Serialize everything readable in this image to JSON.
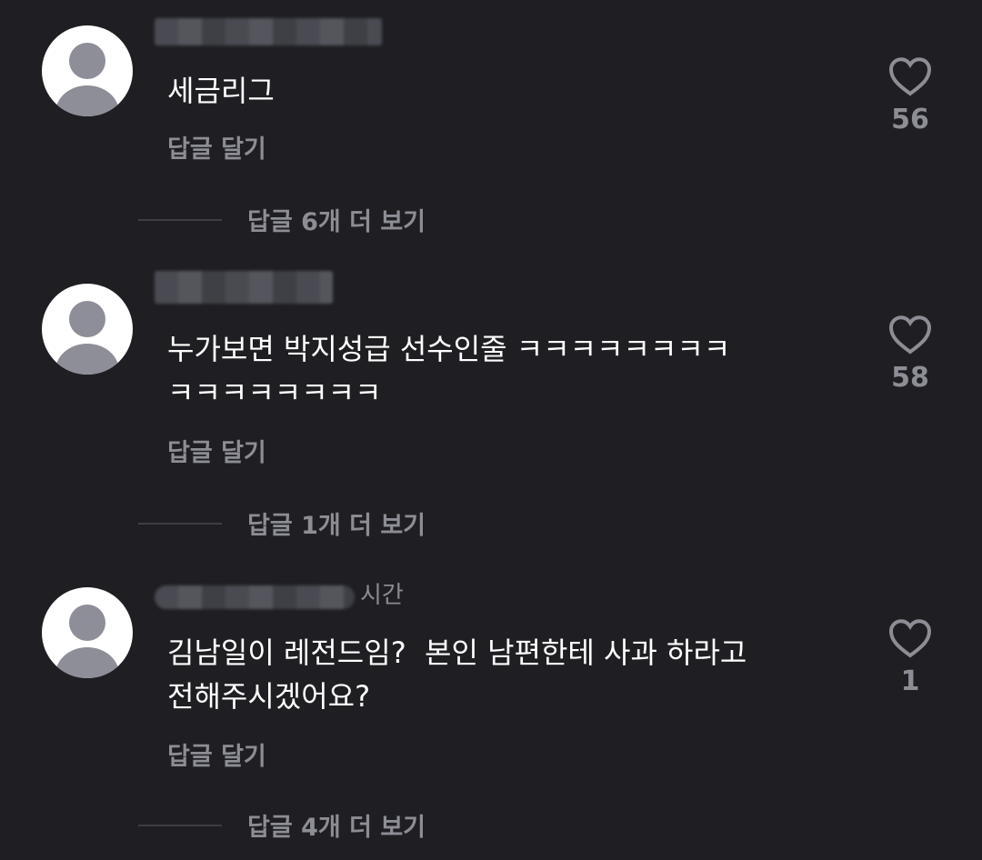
{
  "comments": [
    {
      "username": "",
      "text": "세금리그",
      "reply_label": "답글 달기",
      "view_replies_label": "답글 6개 더 보기",
      "like_count": "56",
      "time_label": ""
    },
    {
      "username": "",
      "text": "누가보면 박지성급 선수인줄 ㅋㅋㅋㅋㅋㅋㅋㅋ\nㅋㅋㅋㅋㅋㅋㅋㅋ",
      "reply_label": "답글 달기",
      "view_replies_label": "답글 1개 더 보기",
      "like_count": "58",
      "time_label": ""
    },
    {
      "username": "",
      "text": "김남일이 레전드임?  본인 남편한테 사과 하라고\n전해주시겠어요?",
      "reply_label": "답글 달기",
      "view_replies_label": "답글 4개 더 보기",
      "like_count": "1",
      "time_label": "시간"
    }
  ],
  "icons": {
    "like": "heart-outline-icon",
    "avatar": "default-user-avatar-icon"
  },
  "colors": {
    "background": "#1f1f23",
    "text_primary": "#ffffff",
    "text_secondary": "#8d8e95",
    "avatar_figure": "#8d8e97"
  }
}
